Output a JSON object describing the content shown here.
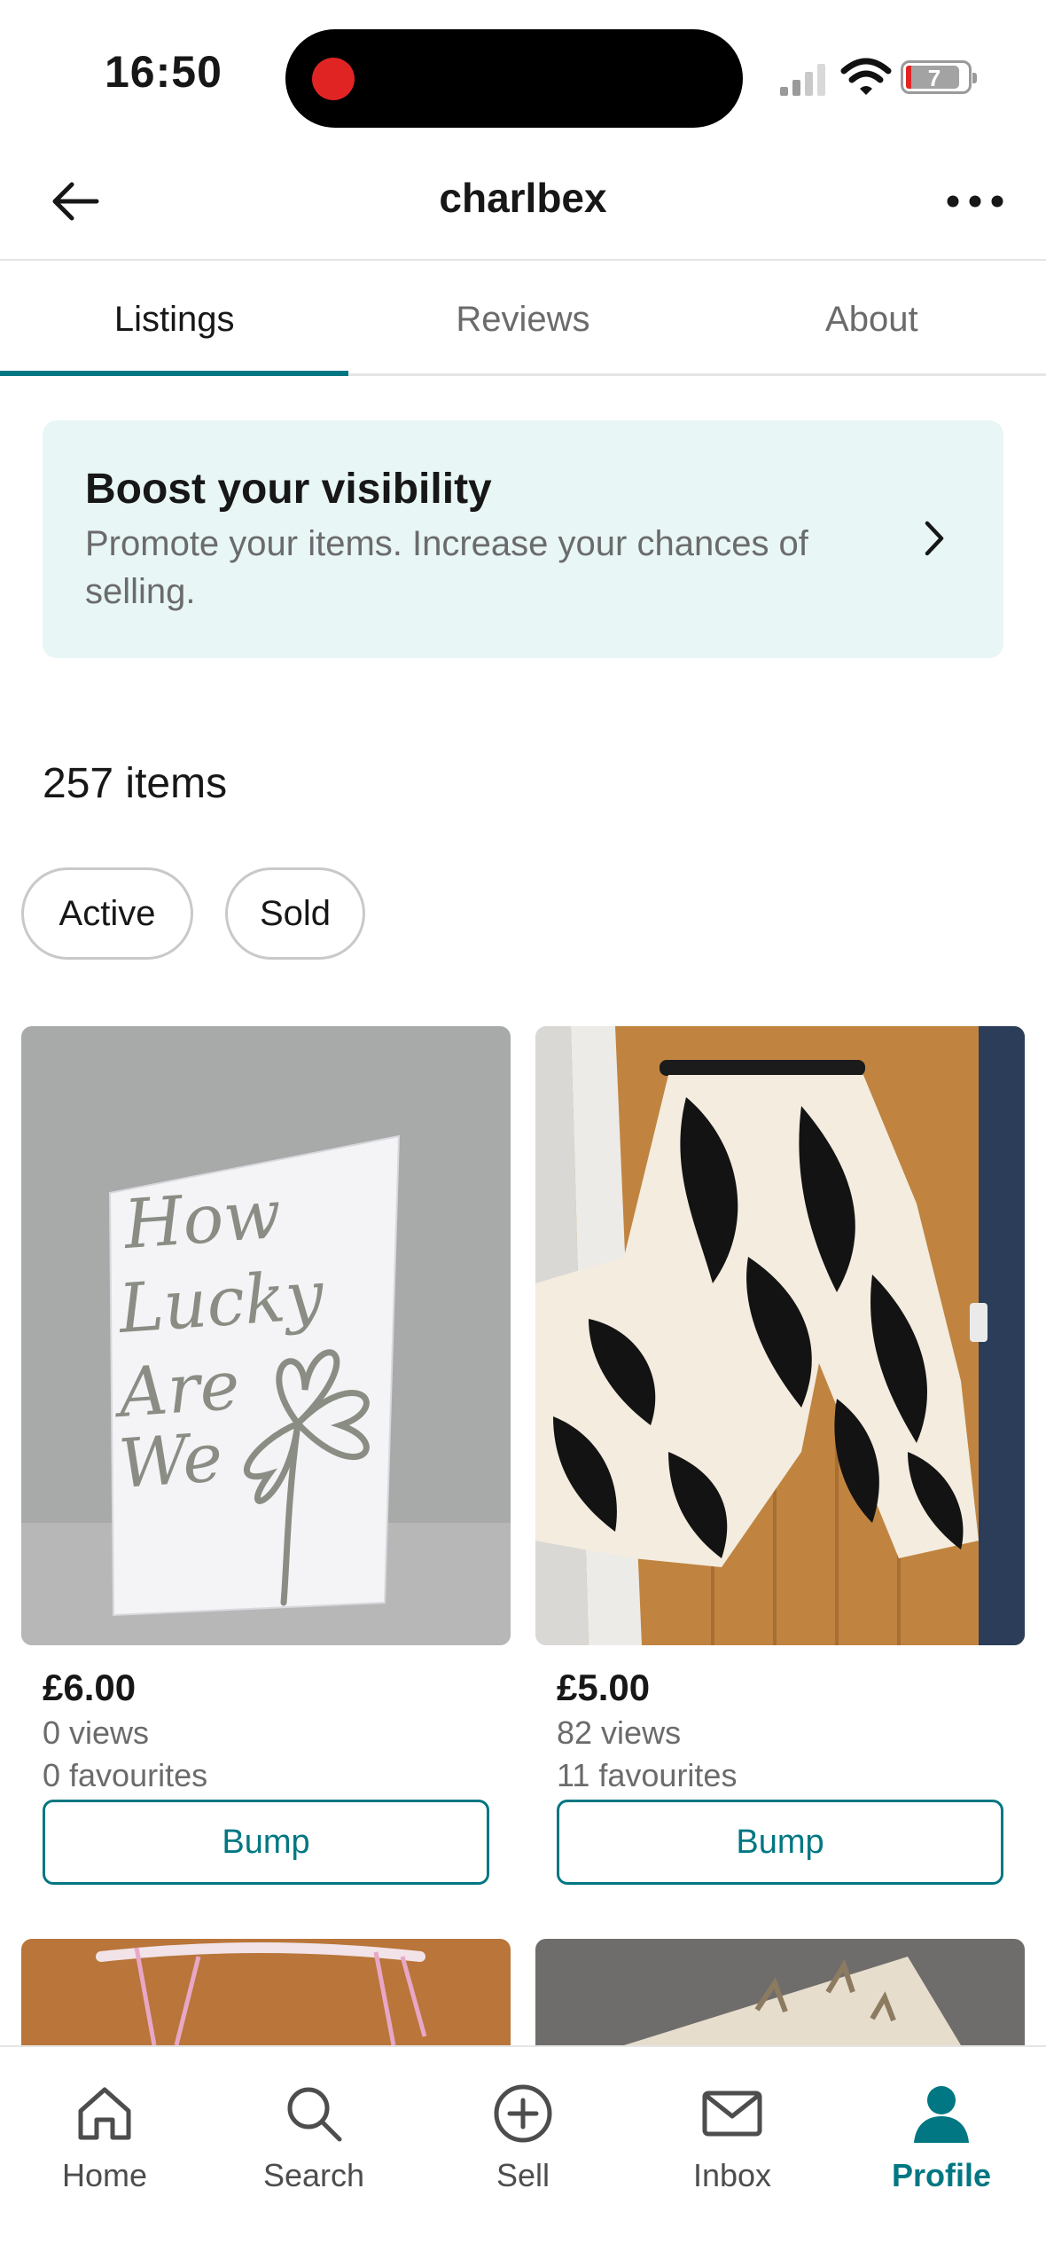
{
  "status_bar": {
    "time": "16:50",
    "battery": "7"
  },
  "header": {
    "title": "charlbex"
  },
  "tabs": [
    {
      "label": "Listings",
      "active": true
    },
    {
      "label": "Reviews",
      "active": false
    },
    {
      "label": "About",
      "active": false
    }
  ],
  "boost": {
    "title": "Boost your visibility",
    "description": "Promote your items. Increase your chances of selling."
  },
  "items_count": "257 items",
  "filters": {
    "active": "Active",
    "sold": "Sold"
  },
  "products": [
    {
      "price": "£6.00",
      "views": "0 views",
      "favourites": "0 favourites",
      "bump_label": "Bump",
      "image_text": [
        "How",
        "Lucky",
        "Are",
        "We"
      ]
    },
    {
      "price": "£5.00",
      "views": "82 views",
      "favourites": "11 favourites",
      "bump_label": "Bump"
    }
  ],
  "nav": {
    "home": "Home",
    "search": "Search",
    "sell": "Sell",
    "inbox": "Inbox",
    "profile": "Profile",
    "accent_color": "#007782"
  }
}
